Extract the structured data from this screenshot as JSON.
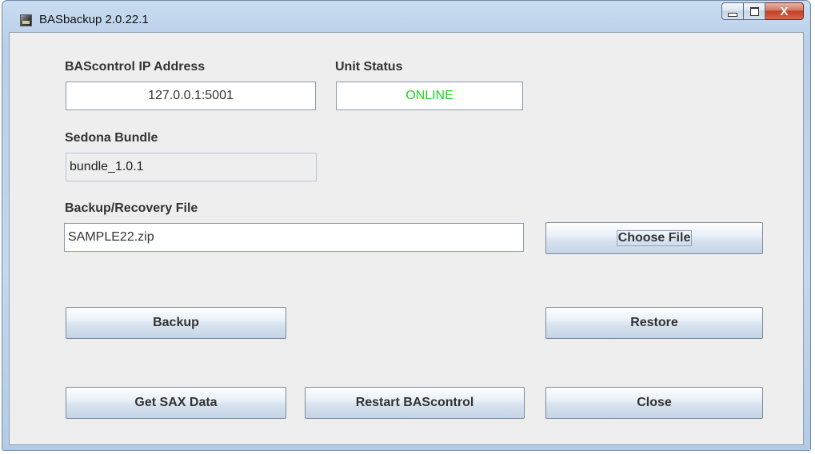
{
  "window": {
    "title": "BASbackup 2.0.22.1"
  },
  "title_controls": {
    "close_glyph": "X"
  },
  "ip": {
    "label": "BAScontrol IP Address",
    "value": "127.0.0.1:5001"
  },
  "unit_status": {
    "label": "Unit Status",
    "value": "ONLINE",
    "color": "#22d022"
  },
  "sedona": {
    "label": "Sedona Bundle",
    "value": "bundle_1.0.1"
  },
  "backup_file": {
    "label": "Backup/Recovery File",
    "value": "SAMPLE22.zip"
  },
  "buttons": {
    "choose_file": "Choose File",
    "backup": "Backup",
    "restore": "Restore",
    "get_sax": "Get SAX Data",
    "restart": "Restart BAScontrol",
    "close": "Close"
  },
  "icons": {
    "app": "app-icon",
    "minimize": "minimize-icon",
    "maximize": "maximize-icon",
    "close": "close-icon"
  }
}
